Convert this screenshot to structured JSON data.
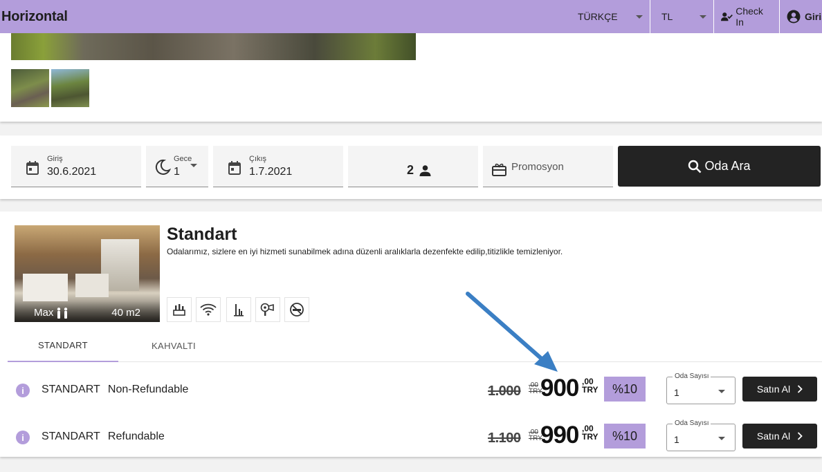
{
  "header": {
    "brand": "Horizontal",
    "language": "TÜRKÇE",
    "currency": "TL",
    "checkin": "Check In",
    "login": "Giriş"
  },
  "search": {
    "checkin_label": "Giriş",
    "checkin_value": "30.6.2021",
    "nights_label": "Gece",
    "nights_value": "1",
    "checkout_label": "Çıkış",
    "checkout_value": "1.7.2021",
    "guests_value": "2",
    "promo_placeholder": "Promosyon",
    "search_button": "Oda Ara"
  },
  "room": {
    "title": "Standart",
    "description": "Odalarımız, sizlere en iyi hizmeti sunabilmek adına düzenli aralıklarla dezenfekte edilip,titizlikle temizleniyor.",
    "max_label": "Max",
    "area": "40 m2",
    "amenity_icons": [
      "minibar-icon",
      "wifi-icon",
      "kettle-icon",
      "hair-dryer-icon",
      "no-smoking-icon"
    ]
  },
  "tabs": [
    {
      "label": "STANDART",
      "active": true
    },
    {
      "label": "KAHVALTI",
      "active": false
    }
  ],
  "rates": [
    {
      "type": "STANDART",
      "name": "Non-Refundable",
      "old_price": "1.000",
      "old_cents": ",00",
      "old_currency": "TRY",
      "price": "900",
      "cents": ",00",
      "currency": "TRY",
      "discount": "%10",
      "qty_label": "Oda Sayısı",
      "qty_value": "1",
      "buy_label": "Satın Al"
    },
    {
      "type": "STANDART",
      "name": "Refundable",
      "old_price": "1.100",
      "old_cents": ",00",
      "old_currency": "TRY",
      "price": "990",
      "cents": ",00",
      "currency": "TRY",
      "discount": "%10",
      "qty_label": "Oda Sayısı",
      "qty_value": "1",
      "buy_label": "Satın Al"
    }
  ],
  "colors": {
    "accent": "#b39ddb",
    "dark": "#232323",
    "annotation_arrow": "#3b7fc4"
  }
}
